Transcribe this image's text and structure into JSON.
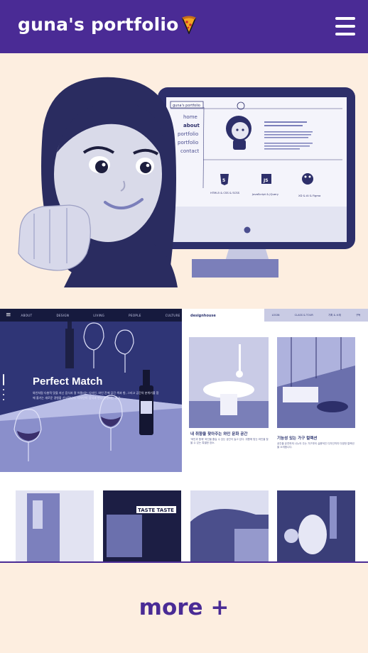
{
  "header": {
    "title": "guna's portfolio",
    "logo_icon": "pizza-slice-icon",
    "menu_icon": "hamburger-menu-icon",
    "bg_color": "#4a2b95"
  },
  "monitor": {
    "site_title": "guna's portfolio",
    "nav": [
      "home",
      "about",
      "portfolio",
      "portfolio",
      "contact"
    ],
    "skills": [
      "HTML5 & CSS & SCSS",
      "JavaScript & jQuery",
      "XD & AI & Figma"
    ]
  },
  "preview": {
    "left_nav": [
      "ABOUT",
      "DESIGN",
      "LIVING",
      "PEOPLE",
      "CULTURE"
    ],
    "left_title": "Perfect Match",
    "left_text": "와인처럼 다층적 맛을 지닌 음식과 잘 어울리는 디자인. 와인 잔에 담긴 색과 향, 그리고 공간의 분위기를 함께 즐기는 새로운 경험을 선사합니다. 디자인이 음식과 만나 완성되는 공간.",
    "right_logo": "designhouse",
    "right_nav": [
      "LOGIN",
      "CLASS & TOUR",
      "기획 & 소재",
      "구독"
    ],
    "card1_title": "내 취향을 찾아주는 와인 문화 공간",
    "card1_text": "'와인과 함께' 와인을 즐길 수 있는 공간이 늘고 있다. 취향에 맞는 와인을 찾을 수 있는 특별한 장소.",
    "card2_title": "기능성 있는 가구 컬렉션",
    "card2_text": "공간을 유연하게 나누어 주는 가구부터 실용적인 디자인까지 다양한 컬렉션을 소개합니다.",
    "tile_text": "TASTE TASTE"
  },
  "more_label": "more +"
}
